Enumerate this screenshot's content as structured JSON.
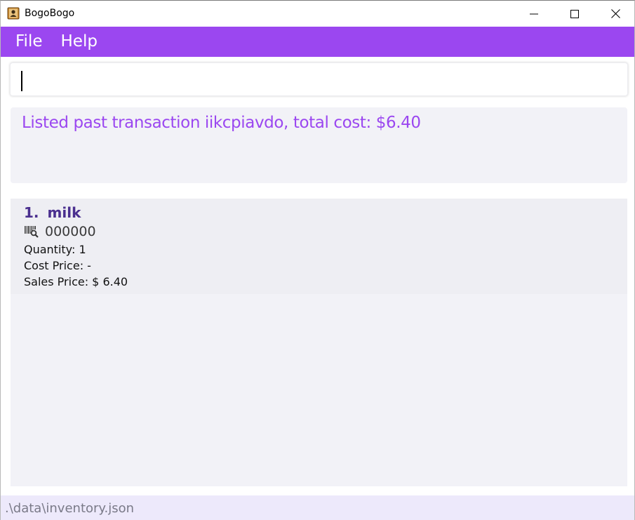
{
  "window": {
    "title": "BogoBogo",
    "icon": "contacts-book-icon"
  },
  "menu": {
    "file_label": "File",
    "help_label": "Help"
  },
  "command": {
    "value": "",
    "placeholder": ""
  },
  "result": {
    "message": "Listed past transaction iikcpiavdo, total cost: $6.40"
  },
  "items": [
    {
      "index": "1.",
      "name": "milk",
      "barcode_icon": "barcode-search-icon",
      "barcode": "000000",
      "quantity": "Quantity: 1",
      "cost_price": "Cost Price: -",
      "sales_price": "Sales Price: $ 6.40"
    }
  ],
  "status": {
    "path": ".\\data\\inventory.json"
  },
  "colors": {
    "accent": "#9b47f0",
    "item_title": "#4a2f8f",
    "panel_bg": "#f2f2f7",
    "status_bg": "#ede9fb"
  }
}
